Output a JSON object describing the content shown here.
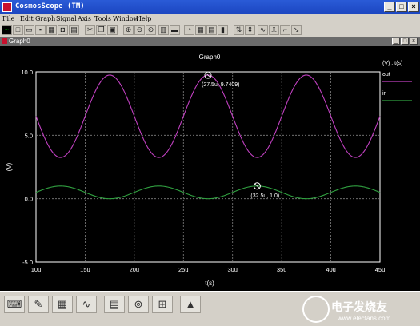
{
  "window": {
    "title": "CosmosScope (TM)"
  },
  "menu": [
    "File",
    "Edit",
    "Graph",
    "Signal",
    "Axis",
    "Tools",
    "Window",
    "Help"
  ],
  "graph_window": {
    "title": "Graph0"
  },
  "colors": {
    "out": "#c040c0",
    "in": "#30a040",
    "grid": "#808080",
    "cursor": "#ffffff"
  },
  "chart_data": {
    "type": "line",
    "title": "Graph0",
    "xlabel": "t(s)",
    "ylabel": "(V)",
    "legend_header": "(V) : t(s)",
    "xlim": [
      10,
      45
    ],
    "ylim": [
      -5,
      10
    ],
    "x_unit": "u",
    "x_ticks": [
      "10u",
      "15u",
      "20u",
      "25u",
      "30u",
      "35u",
      "40u",
      "45u"
    ],
    "y_ticks": [
      "10.0",
      "5.0",
      "0.0",
      "-5.0"
    ],
    "y_tick_values": [
      10,
      5,
      0,
      -5
    ],
    "series": [
      {
        "name": "out",
        "offset": 6.5,
        "amplitude": 3.25,
        "period": 10,
        "peak_at": 27.5
      },
      {
        "name": "in",
        "offset": 0.5,
        "amplitude": 0.5,
        "period": 10,
        "peak_at": 32.5
      }
    ],
    "markers": [
      {
        "x": 27.5,
        "y": 9.7409,
        "label": "(27.5u, 9.7409)"
      },
      {
        "x": 32.5,
        "y": 1.0,
        "label": "(32.5u, 1.0)"
      }
    ]
  },
  "watermark": {
    "line1": "电子发烧友",
    "line2": "www.elecfans.com"
  }
}
